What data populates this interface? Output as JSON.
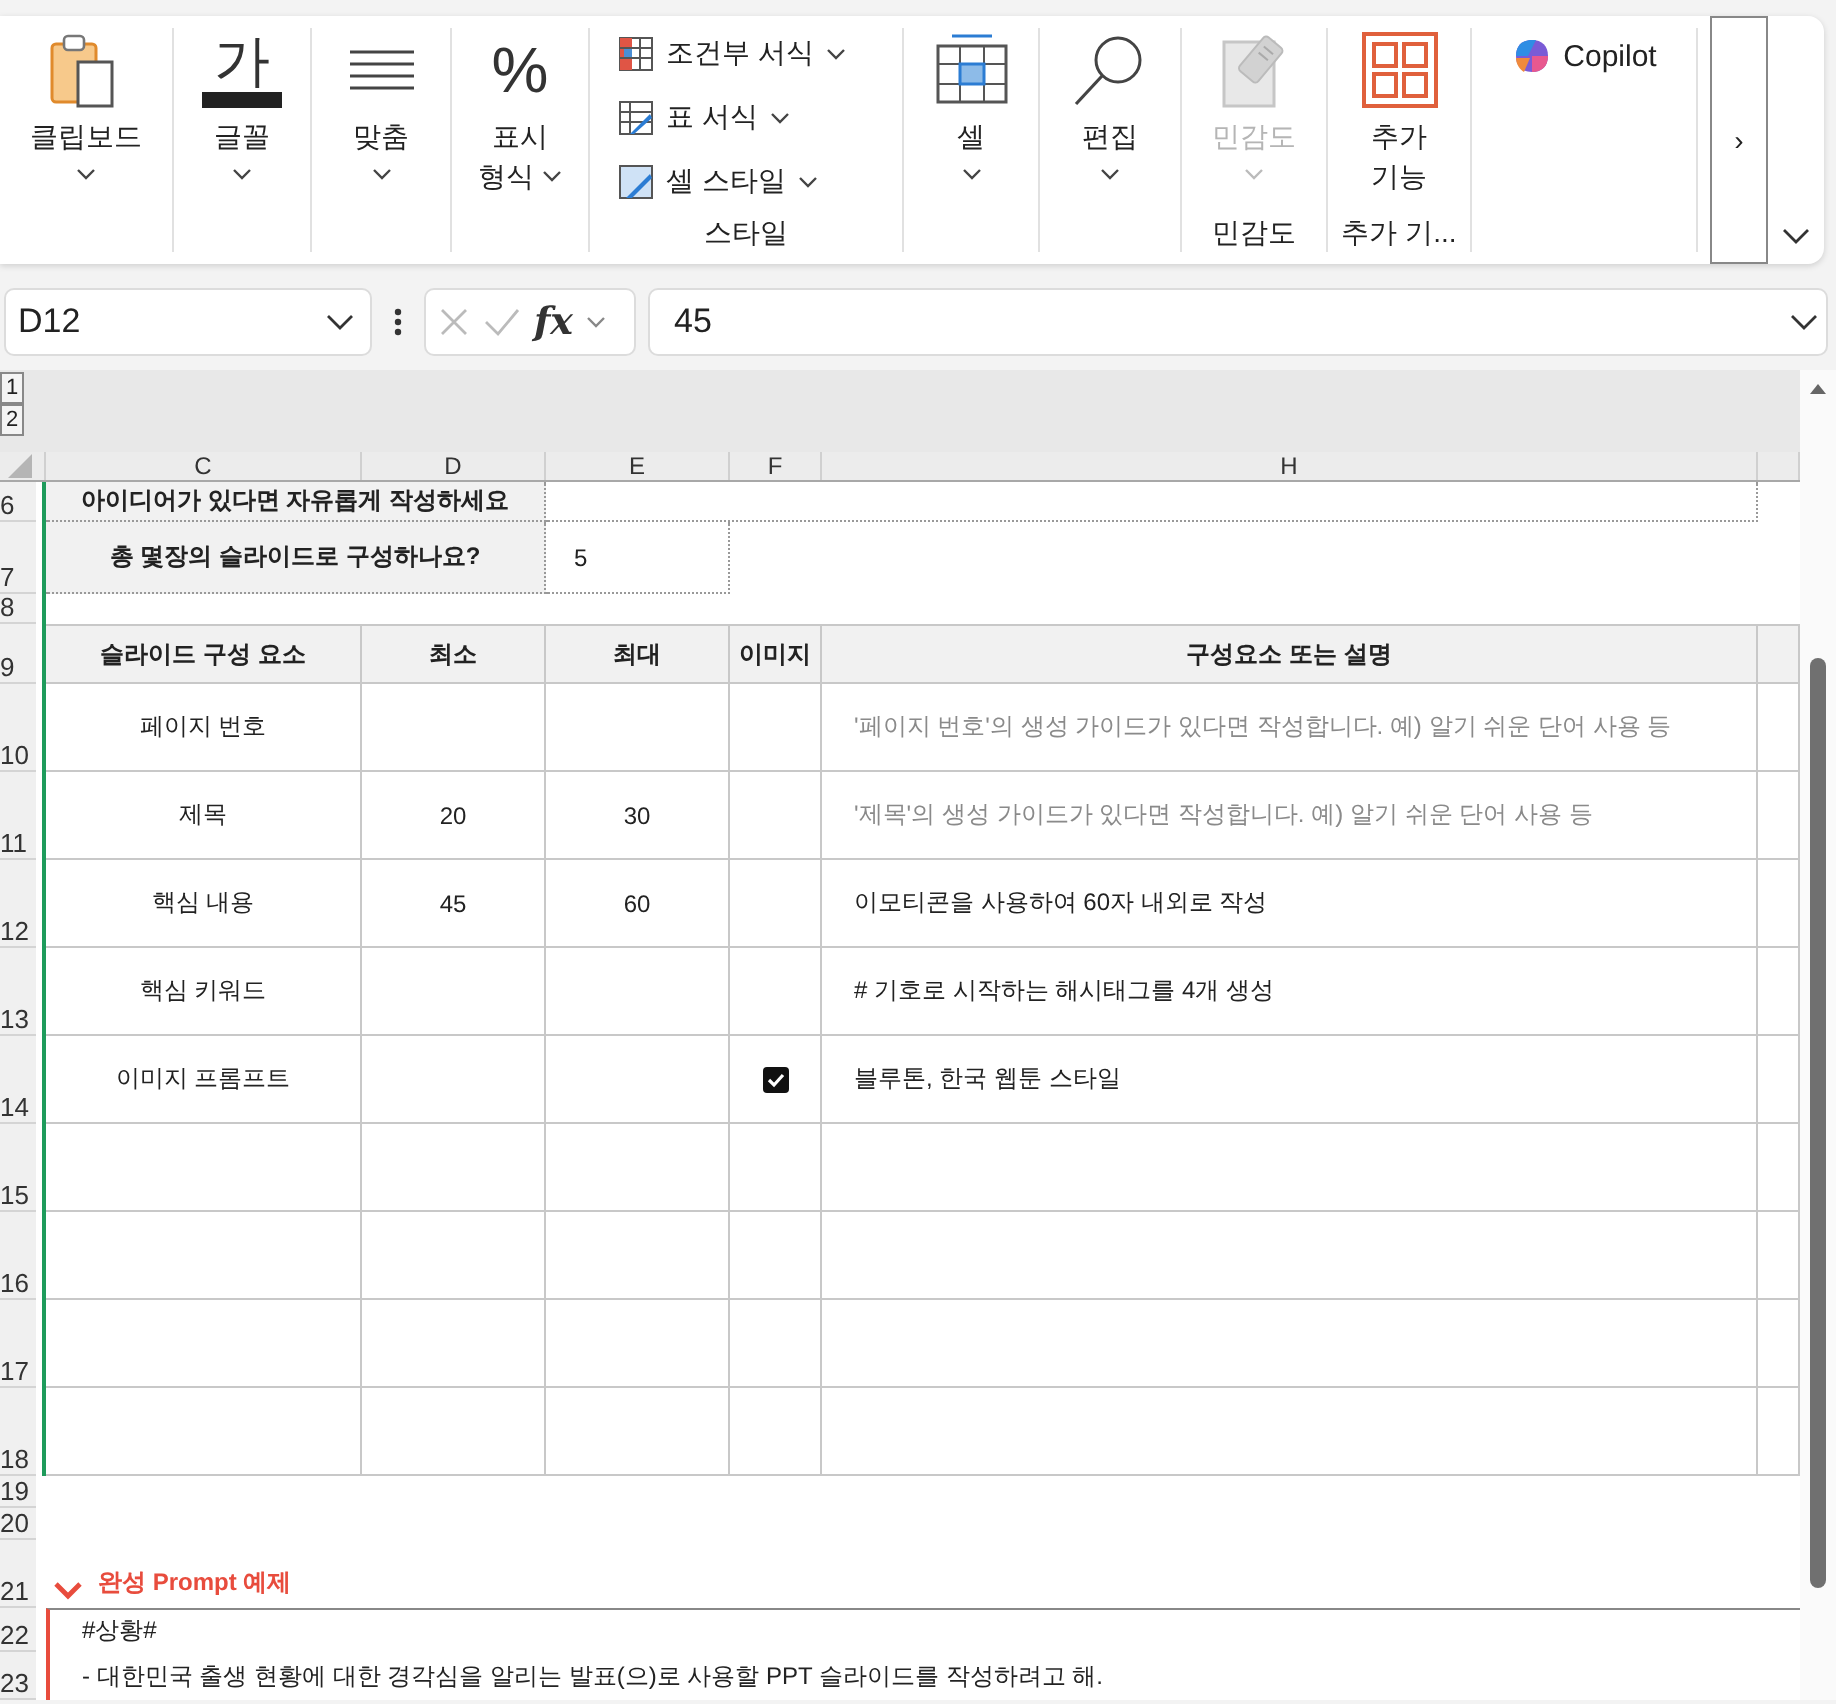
{
  "ribbon": {
    "groups": [
      {
        "kind": "large",
        "lines": [
          "클립보드"
        ],
        "dropdown": true,
        "disabled": false
      },
      {
        "kind": "large",
        "glyph": "가",
        "lines": [
          "글꼴"
        ],
        "dropdown": true,
        "disabled": false
      },
      {
        "kind": "large",
        "lines": [
          "맞춤"
        ],
        "dropdown": true,
        "disabled": false
      },
      {
        "kind": "large",
        "glyph": "%",
        "lines": [
          "표시",
          "형식"
        ],
        "dropdown": true,
        "disabled": false
      },
      {
        "kind": "list",
        "title": "스타일",
        "items": [
          {
            "label": "조건부 서식"
          },
          {
            "label": "표 서식"
          },
          {
            "label": "셀 스타일"
          }
        ]
      },
      {
        "kind": "large",
        "lines": [
          "셀"
        ],
        "dropdown": true,
        "disabled": false
      },
      {
        "kind": "large",
        "lines": [
          "편집"
        ],
        "dropdown": true,
        "disabled": false
      },
      {
        "kind": "large",
        "lines": [
          "민감도"
        ],
        "dropdown": true,
        "disabled": true,
        "title": "민감도"
      },
      {
        "kind": "large",
        "lines": [
          "추가",
          "기능"
        ],
        "dropdown": false,
        "disabled": false,
        "title": "추가 기..."
      },
      {
        "kind": "copilot",
        "label": "Copilot"
      }
    ],
    "scroll_button": "›"
  },
  "formula_bar": {
    "name_box": "D12",
    "function_label": "fx",
    "value": "45"
  },
  "outline_levels": [
    "1",
    "2"
  ],
  "columns": [
    "C",
    "D",
    "E",
    "F",
    "H"
  ],
  "row_numbers": [
    "6",
    "7",
    "8",
    "9",
    "10",
    "11",
    "12",
    "13",
    "14",
    "15",
    "16",
    "17",
    "18",
    "19",
    "20",
    "21",
    "22",
    "23"
  ],
  "questions": [
    {
      "label": "아이디어가 있다면 자유롭게 작성하세요"
    },
    {
      "label": "총 몇장의 슬라이드로 구성하나요?",
      "value": "5"
    }
  ],
  "table": {
    "columns": [
      "슬라이드 구성 요소",
      "최소",
      "최대",
      "이미지",
      "구성요소 또는 설명"
    ],
    "rows": [
      {
        "component": "페이지 번호",
        "image": false,
        "description": "'페이지 번호'의 생성 가이드가 있다면 작성합니다. 예) 알기 쉬운 단어 사용 등",
        "hint": true
      },
      {
        "component": "제목",
        "min": "20",
        "max": "30",
        "image": false,
        "description": "'제목'의 생성 가이드가 있다면 작성합니다. 예) 알기 쉬운 단어 사용 등",
        "hint": true
      },
      {
        "component": "핵심 내용",
        "min": "45",
        "max": "60",
        "image": false,
        "description": "이모티콘을 사용하여 60자 내외로 작성",
        "hint": false
      },
      {
        "component": "핵심 키워드",
        "image": false,
        "description": "# 기호로 시작하는 해시태그를 4개 생성",
        "hint": false
      },
      {
        "component": "이미지 프롬프트",
        "image": true,
        "description": "블루톤, 한국 웹툰 스타일",
        "hint": false
      },
      {
        "image": false
      },
      {
        "image": false
      },
      {
        "image": false
      },
      {
        "image": false
      }
    ]
  },
  "example": {
    "title": "완성 Prompt 예제",
    "expanded": true,
    "lines": [
      "#상황#",
      "- 대한민국 출생 현황에 대한 경각심을 알리는 발표(으)로 사용할 PPT 슬라이드를 작성하려고 해."
    ]
  }
}
